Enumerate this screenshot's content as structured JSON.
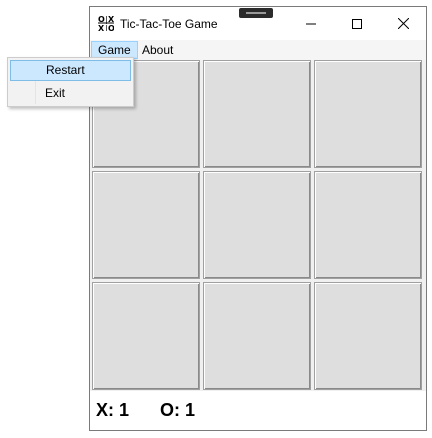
{
  "window": {
    "title": "Tic-Tac-Toe Game",
    "app_icon": "tictactoe-grid-icon"
  },
  "title_controls": [
    "minimize-icon",
    "maximize-icon",
    "close-icon"
  ],
  "menubar": {
    "items": [
      "Game",
      "About"
    ]
  },
  "game_menu": {
    "items": [
      "Restart",
      "Exit"
    ],
    "highlighted": "Restart"
  },
  "board": {
    "cells": [
      "",
      "",
      "",
      "",
      "",
      "",
      "",
      "",
      ""
    ]
  },
  "score": {
    "x": "X: 1",
    "o": "O: 1"
  }
}
